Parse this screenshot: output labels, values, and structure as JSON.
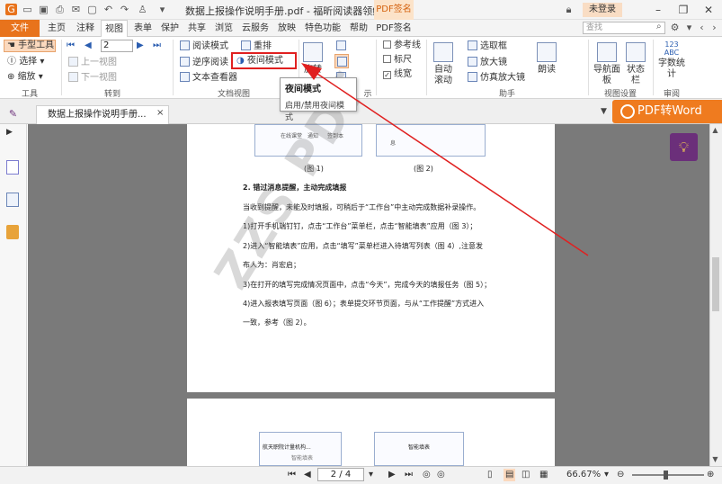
{
  "titlebar": {
    "title": "数据上报操作说明手册.pdf - 福昕阅读器领鲜版",
    "pdf_sign_tab": "PDF签名",
    "login": "未登录"
  },
  "tabs": [
    "文件",
    "主页",
    "注释",
    "视图",
    "表单",
    "保护",
    "共享",
    "浏览",
    "云服务",
    "放映",
    "特色功能",
    "帮助",
    "PDF签名"
  ],
  "search": {
    "placeholder": "查找"
  },
  "ribbon": {
    "tools": {
      "hand": "手型工具",
      "select": "选择",
      "zoom": "缩放",
      "group": "工具"
    },
    "goto": {
      "page": "2",
      "prev_view": "上一视图",
      "next_view": "下一视图",
      "group": "转到"
    },
    "docview": {
      "read_mode": "阅读模式",
      "reverse_read": "逆序阅读",
      "text_viewer": "文本查看器",
      "reflow": "重排",
      "night_mode": "夜间模式",
      "group": "文档视图"
    },
    "rotate": "旋转",
    "page_display_group": "示",
    "checks": {
      "ref_line": "参考线",
      "ruler": "标尺",
      "line_width": "线宽"
    },
    "assist": {
      "auto_scroll": "自动滚动",
      "select_box": "选取框",
      "magnifier": "放大镜",
      "loupe": "仿真放大镜",
      "read_aloud": "朗读",
      "group": "助手"
    },
    "viewset": {
      "nav_panel": "导航面板",
      "status_bar": "状态栏",
      "group": "视图设置"
    },
    "wordcount": {
      "icon_text": "123 ABC",
      "label": "字数统计",
      "group": "审阅"
    }
  },
  "tooltip": {
    "title": "夜间模式",
    "desc": "启用/禁用夜间模式"
  },
  "doc_tab": {
    "label": "数据上报操作说明手册...",
    "close": "×"
  },
  "pdf2word": "PDF转Word",
  "page_content": {
    "fig1_caption": "(图 1)",
    "fig2_caption": "(图 2)",
    "fig1_labels": [
      "在线课堂",
      "通知",
      "签到本"
    ],
    "fig2_label": "息",
    "heading": "2. 错过消息提醒，主动完成填报",
    "lines": [
      "当收到提醒，未能及时填报，可稍后于“工作台”中主动完成数据补录操作。",
      "1)打开手机端钉钉，点击“工作台”菜单栏，点击“智能填表”应用（图 3）；",
      "2)进入“智能填表”应用，点击“填写”菜单栏进入待填写列表（图 4）,注意发",
      "布人为：肖宏启；",
      "3)在打开的填写完成情况页面中，点击“今天”，完成今天的填报任务（图 5）；",
      "4)进入报表填写页面（图 6）；表单提交环节页面，与从“工作提醒”方式进入",
      "一致，参考（图 2）。"
    ],
    "watermark": "ZZS PDF",
    "page2_labels": [
      "航天职院计量机构...",
      "智能填表",
      "智能填表"
    ]
  },
  "status": {
    "page_indicator": "2 / 4",
    "zoom": "66.67%"
  },
  "colors": {
    "accent": "#e8731c",
    "highlight": "#e02020",
    "bulb_bg": "#6b2f7a"
  }
}
